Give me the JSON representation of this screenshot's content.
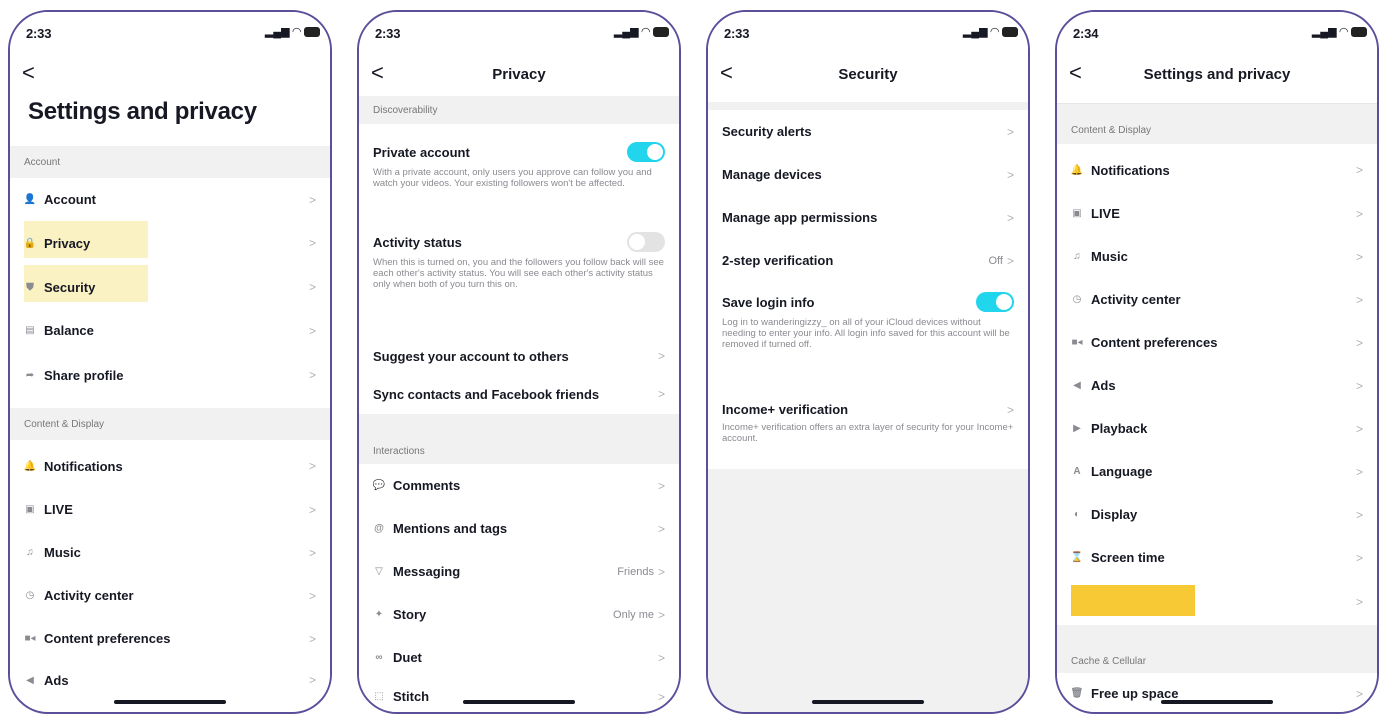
{
  "status": {
    "p1_time": "2:33",
    "p2_time": "2:33",
    "p3_time": "2:33",
    "p4_time": "2:34",
    "signal": ".ıl",
    "wifi": "wifi"
  },
  "p1": {
    "back": "<",
    "title": "Settings and privacy",
    "sections": {
      "account": "Account",
      "content": "Content & Display"
    },
    "items": {
      "account": "Account",
      "privacy": "Privacy",
      "security": "Security",
      "balance": "Balance",
      "share_profile": "Share profile",
      "notifications": "Notifications",
      "live": "LIVE",
      "music": "Music",
      "activity_center": "Activity center",
      "content_preferences": "Content preferences",
      "ads": "Ads"
    },
    "highlight_color": "#fbf2c4"
  },
  "p2": {
    "back": "<",
    "title": "Privacy",
    "sections": {
      "discoverability": "Discoverability",
      "interactions": "Interactions"
    },
    "private_account": {
      "label": "Private account",
      "on": true,
      "desc": "With a private account, only users you approve can follow you and watch your videos. Your existing followers won't be affected."
    },
    "activity_status": {
      "label": "Activity status",
      "on": false,
      "desc": "When this is turned on, you and the followers you follow back will see each other's activity status. You will see each other's activity status only when both of you turn this on."
    },
    "suggest": "Suggest your account to others",
    "sync": "Sync contacts and Facebook friends",
    "items": {
      "comments": "Comments",
      "mentions": "Mentions and tags",
      "messaging": "Messaging",
      "messaging_val": "Friends",
      "story": "Story",
      "story_val": "Only me",
      "duet": "Duet",
      "stitch": "Stitch"
    }
  },
  "p3": {
    "back": "<",
    "title": "Security",
    "security_alerts": "Security alerts",
    "manage_devices": "Manage devices",
    "manage_app_permissions": "Manage app permissions",
    "two_step": "2-step verification",
    "two_step_val": "Off",
    "save_login": {
      "label": "Save login info",
      "on": true,
      "desc": "Log in to wanderingizzy_ on all of your iCloud devices without needing to enter your info. All login info saved for this account will be removed if turned off."
    },
    "income": {
      "label": "Income+ verification",
      "desc": "Income+ verification offers an extra layer of security for your Income+ account."
    }
  },
  "p4": {
    "back": "<",
    "title": "Settings and privacy",
    "sections": {
      "content": "Content & Display",
      "cache": "Cache & Cellular"
    },
    "items": {
      "notifications": "Notifications",
      "live": "LIVE",
      "music": "Music",
      "activity_center": "Activity center",
      "content_preferences": "Content preferences",
      "ads": "Ads",
      "playback": "Playback",
      "language": "Language",
      "display": "Display",
      "screen_time": "Screen time",
      "free_up_space": "Free up space"
    },
    "redaction_color": "#f6c935"
  },
  "chevron": ">",
  "accent": "#20d5ec",
  "frame_color": "#5b4f9c"
}
